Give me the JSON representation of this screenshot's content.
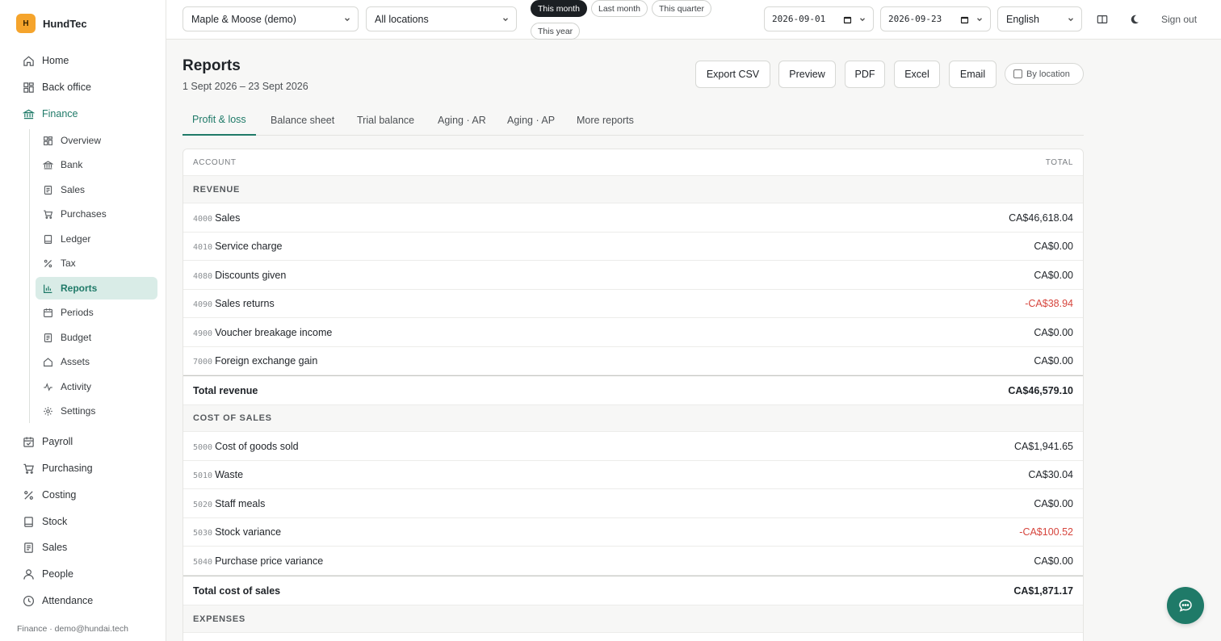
{
  "brand": {
    "logo_letter": "H",
    "name": "HundTec"
  },
  "sidebar": {
    "items": [
      {
        "label": "Home",
        "icon": "home-icon"
      },
      {
        "label": "Back office",
        "icon": "grid-icon"
      },
      {
        "label": "Finance",
        "icon": "bank-icon",
        "active": true
      }
    ],
    "finance_sub": [
      {
        "label": "Overview",
        "icon": "grid-icon"
      },
      {
        "label": "Bank",
        "icon": "bank-icon"
      },
      {
        "label": "Sales",
        "icon": "receipt-icon"
      },
      {
        "label": "Purchases",
        "icon": "cart-icon"
      },
      {
        "label": "Ledger",
        "icon": "book-icon"
      },
      {
        "label": "Tax",
        "icon": "percent-icon"
      },
      {
        "label": "Reports",
        "icon": "bar-chart-icon",
        "active": true
      },
      {
        "label": "Periods",
        "icon": "calendar-icon"
      },
      {
        "label": "Budget",
        "icon": "receipt-icon"
      },
      {
        "label": "Assets",
        "icon": "home-icon"
      },
      {
        "label": "Activity",
        "icon": "activity-icon"
      },
      {
        "label": "Settings",
        "icon": "gear-icon"
      }
    ],
    "items_after": [
      {
        "label": "Payroll",
        "icon": "calendar-check-icon"
      },
      {
        "label": "Purchasing",
        "icon": "cart-icon"
      },
      {
        "label": "Costing",
        "icon": "percent-icon"
      },
      {
        "label": "Stock",
        "icon": "book-icon"
      },
      {
        "label": "Sales",
        "icon": "receipt-icon"
      },
      {
        "label": "People",
        "icon": "user-icon"
      },
      {
        "label": "Attendance",
        "icon": "clock-icon"
      }
    ],
    "footer": "Finance · demo@hundai.tech"
  },
  "topbar": {
    "company": "Maple & Moose (demo)",
    "location": "All locations",
    "ranges": [
      "This month",
      "Last month",
      "This quarter",
      "This year"
    ],
    "active_range": "This month",
    "date_from": "2026-09-01",
    "date_to": "2026-09-23",
    "language": "English",
    "signout": "Sign out"
  },
  "page": {
    "title": "Reports",
    "subtitle": "1 Sept 2026 – 23 Sept 2026",
    "buttons": {
      "export_csv": "Export CSV",
      "preview": "Preview",
      "pdf": "PDF",
      "excel": "Excel",
      "email": "Email",
      "by_location": "By location"
    },
    "tabs": [
      "Profit & loss",
      "Balance sheet",
      "Trial balance",
      "Aging · AR",
      "Aging · AP",
      "More reports"
    ]
  },
  "table": {
    "col_account": "ACCOUNT",
    "col_total": "TOTAL",
    "revenue_label": "REVENUE",
    "revenue_rows": [
      {
        "num": "4000",
        "name": "Sales",
        "amount": "CA$46,618.04"
      },
      {
        "num": "4010",
        "name": "Service charge",
        "amount": "CA$0.00"
      },
      {
        "num": "4080",
        "name": "Discounts given",
        "amount": "CA$0.00"
      },
      {
        "num": "4090",
        "name": "Sales returns",
        "amount": "-CA$38.94",
        "negative": true
      },
      {
        "num": "4900",
        "name": "Voucher breakage income",
        "amount": "CA$0.00"
      },
      {
        "num": "7000",
        "name": "Foreign exchange gain",
        "amount": "CA$0.00"
      }
    ],
    "total_revenue_label": "Total revenue",
    "total_revenue": "CA$46,579.10",
    "cos_label": "COST OF SALES",
    "cos_rows": [
      {
        "num": "5000",
        "name": "Cost of goods sold",
        "amount": "CA$1,941.65"
      },
      {
        "num": "5010",
        "name": "Waste",
        "amount": "CA$30.04"
      },
      {
        "num": "5020",
        "name": "Staff meals",
        "amount": "CA$0.00"
      },
      {
        "num": "5030",
        "name": "Stock variance",
        "amount": "-CA$100.52",
        "negative": true
      },
      {
        "num": "5040",
        "name": "Purchase price variance",
        "amount": "CA$0.00"
      }
    ],
    "total_cos_label": "Total cost of sales",
    "total_cos": "CA$1,871.17",
    "expenses_label": "EXPENSES"
  },
  "colors": {
    "accent": "#1f7a68",
    "negative": "#d6453d",
    "brand": "#f5a42c"
  }
}
